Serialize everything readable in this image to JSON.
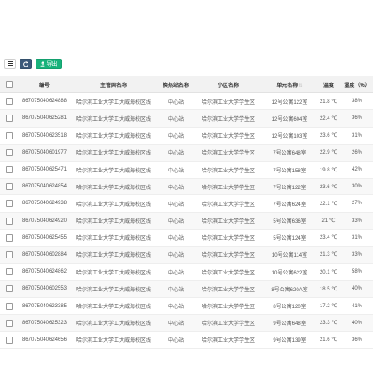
{
  "toolbar": {
    "menu_icon": "menu-icon",
    "refresh_icon": "refresh-icon",
    "export_icon": "export-icon",
    "export_label": "导出",
    "colors": {
      "refresh": "#3c5a7a",
      "export": "#18b27b"
    }
  },
  "table": {
    "columns": {
      "id": "编号",
      "pipeline": "主管网名称",
      "station": "换热站名称",
      "community": "小区名称",
      "unit": "单元名称",
      "temperature": "温度",
      "humidity": "湿度（%）"
    },
    "rows": [
      {
        "id": "867075040624888",
        "pipeline": "哈尔滨工业大学工大威海校区线",
        "station": "中心站",
        "community": "哈尔滨工业大学学生区",
        "unit": "12号公寓122室",
        "temperature": "21.8 ℃",
        "humidity": "38%"
      },
      {
        "id": "867075040625281",
        "pipeline": "哈尔滨工业大学工大威海校区线",
        "station": "中心站",
        "community": "哈尔滨工业大学学生区",
        "unit": "12号公寓604室",
        "temperature": "22.4 ℃",
        "humidity": "36%"
      },
      {
        "id": "867075040623518",
        "pipeline": "哈尔滨工业大学工大威海校区线",
        "station": "中心站",
        "community": "哈尔滨工业大学学生区",
        "unit": "12号公寓103室",
        "temperature": "23.6 ℃",
        "humidity": "31%"
      },
      {
        "id": "867075040601977",
        "pipeline": "哈尔滨工业大学工大威海校区线",
        "station": "中心站",
        "community": "哈尔滨工业大学学生区",
        "unit": "7号公寓648室",
        "temperature": "22.9 ℃",
        "humidity": "26%"
      },
      {
        "id": "867075040625471",
        "pipeline": "哈尔滨工业大学工大威海校区线",
        "station": "中心站",
        "community": "哈尔滨工业大学学生区",
        "unit": "7号公寓158室",
        "temperature": "19.8 ℃",
        "humidity": "42%"
      },
      {
        "id": "867075040624854",
        "pipeline": "哈尔滨工业大学工大威海校区线",
        "station": "中心站",
        "community": "哈尔滨工业大学学生区",
        "unit": "7号公寓122室",
        "temperature": "23.6 ℃",
        "humidity": "30%"
      },
      {
        "id": "867075040624938",
        "pipeline": "哈尔滨工业大学工大威海校区线",
        "station": "中心站",
        "community": "哈尔滨工业大学学生区",
        "unit": "7号公寓624室",
        "temperature": "22.1 ℃",
        "humidity": "27%"
      },
      {
        "id": "867075040624920",
        "pipeline": "哈尔滨工业大学工大威海校区线",
        "station": "中心站",
        "community": "哈尔滨工业大学学生区",
        "unit": "5号公寓636室",
        "temperature": "21 ℃",
        "humidity": "33%"
      },
      {
        "id": "867075040625455",
        "pipeline": "哈尔滨工业大学工大威海校区线",
        "station": "中心站",
        "community": "哈尔滨工业大学学生区",
        "unit": "5号公寓124室",
        "temperature": "23.4 ℃",
        "humidity": "31%"
      },
      {
        "id": "867075040602884",
        "pipeline": "哈尔滨工业大学工大威海校区线",
        "station": "中心站",
        "community": "哈尔滨工业大学学生区",
        "unit": "10号公寓114室",
        "temperature": "21.3 ℃",
        "humidity": "33%"
      },
      {
        "id": "867075040624862",
        "pipeline": "哈尔滨工业大学工大威海校区线",
        "station": "中心站",
        "community": "哈尔滨工业大学学生区",
        "unit": "10号公寓622室",
        "temperature": "20.1 ℃",
        "humidity": "58%"
      },
      {
        "id": "867075040602553",
        "pipeline": "哈尔滨工业大学工大威海校区线",
        "station": "中心站",
        "community": "哈尔滨工业大学学生区",
        "unit": "8号公寓620A室",
        "temperature": "18.5 ℃",
        "humidity": "40%"
      },
      {
        "id": "867075040623385",
        "pipeline": "哈尔滨工业大学工大威海校区线",
        "station": "中心站",
        "community": "哈尔滨工业大学学生区",
        "unit": "8号公寓120室",
        "temperature": "17.2 ℃",
        "humidity": "41%"
      },
      {
        "id": "867075040625323",
        "pipeline": "哈尔滨工业大学工大威海校区线",
        "station": "中心站",
        "community": "哈尔滨工业大学学生区",
        "unit": "9号公寓648室",
        "temperature": "23.3 ℃",
        "humidity": "40%"
      },
      {
        "id": "867075040624656",
        "pipeline": "哈尔滨工业大学工大威海校区线",
        "station": "中心站",
        "community": "哈尔滨工业大学学生区",
        "unit": "9号公寓139室",
        "temperature": "21.6 ℃",
        "humidity": "36%"
      }
    ]
  }
}
